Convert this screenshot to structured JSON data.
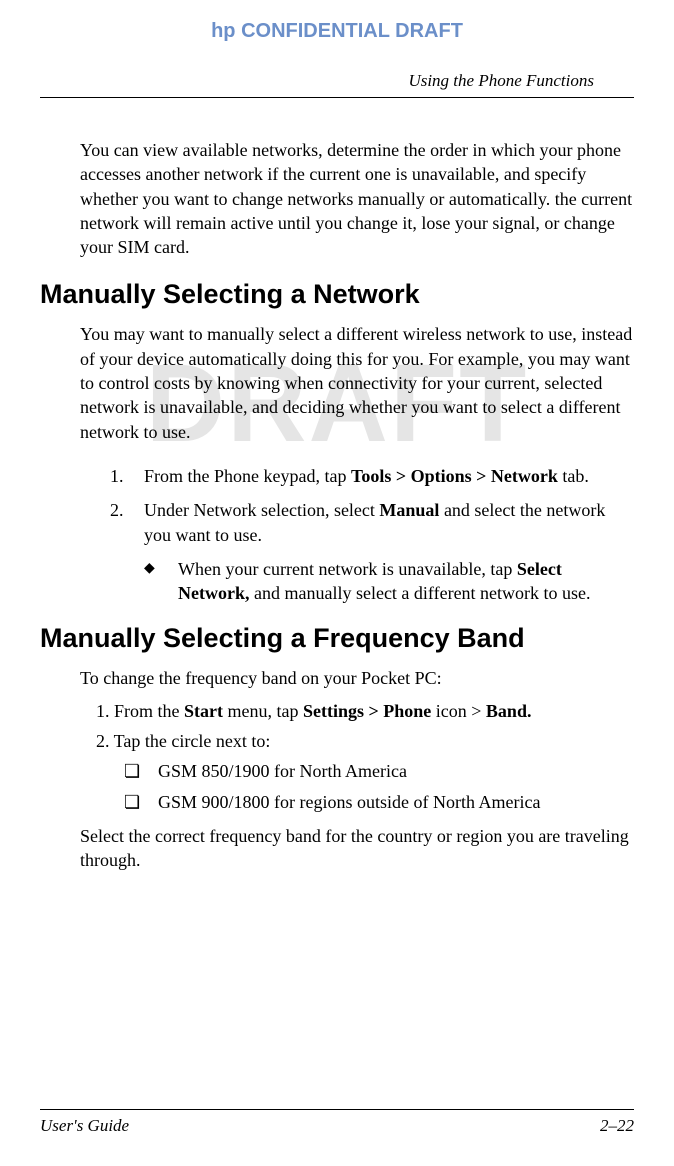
{
  "header": {
    "banner": "hp CONFIDENTIAL DRAFT",
    "section": "Using the Phone Functions"
  },
  "watermark": "DRAFT",
  "intro": "You can view available networks, determine the order in which your phone accesses another network if the current one is unavailable, and specify whether you want to change networks manually or automatically. the current network will remain active until you change it, lose your signal, or change your SIM card.",
  "section1": {
    "heading": "Manually Selecting a Network",
    "para": "You may want to manually select a different wireless network to use, instead of your device automatically doing this for you. For example, you may want to control costs by knowing when connectivity for your current, selected network is unavailable, and deciding whether you want to select a different network to use.",
    "step1_num": "1.",
    "step1_pre": "From the Phone keypad, tap ",
    "step1_bold": "Tools > Options > Network",
    "step1_post": " tab.",
    "step2_num": "2.",
    "step2_pre": "Under Network selection, select ",
    "step2_bold": "Manual",
    "step2_post": " and select the network you want to use.",
    "sub_marker": "◆",
    "sub_pre": "When your current network is unavailable, tap ",
    "sub_bold": "Select Network,",
    "sub_post": " and manually select a different network to use."
  },
  "section2": {
    "heading": "Manually Selecting a Frequency Band",
    "para": "To change the frequency band on your Pocket PC:",
    "step1_pre": "1. From the ",
    "step1_b1": "Start",
    "step1_mid1": " menu, tap ",
    "step1_b2": "Settings > Phone",
    "step1_mid2": " icon > ",
    "step1_b3": "Band.",
    "step2": "2. Tap the circle next to:",
    "opt_marker": "❏",
    "opt1": "GSM 850/1900 for North America",
    "opt2": "GSM 900/1800 for regions outside of North America",
    "closing": "Select the correct frequency band for the country or region you are traveling through."
  },
  "footer": {
    "left": "User's Guide",
    "right": "2–22"
  }
}
